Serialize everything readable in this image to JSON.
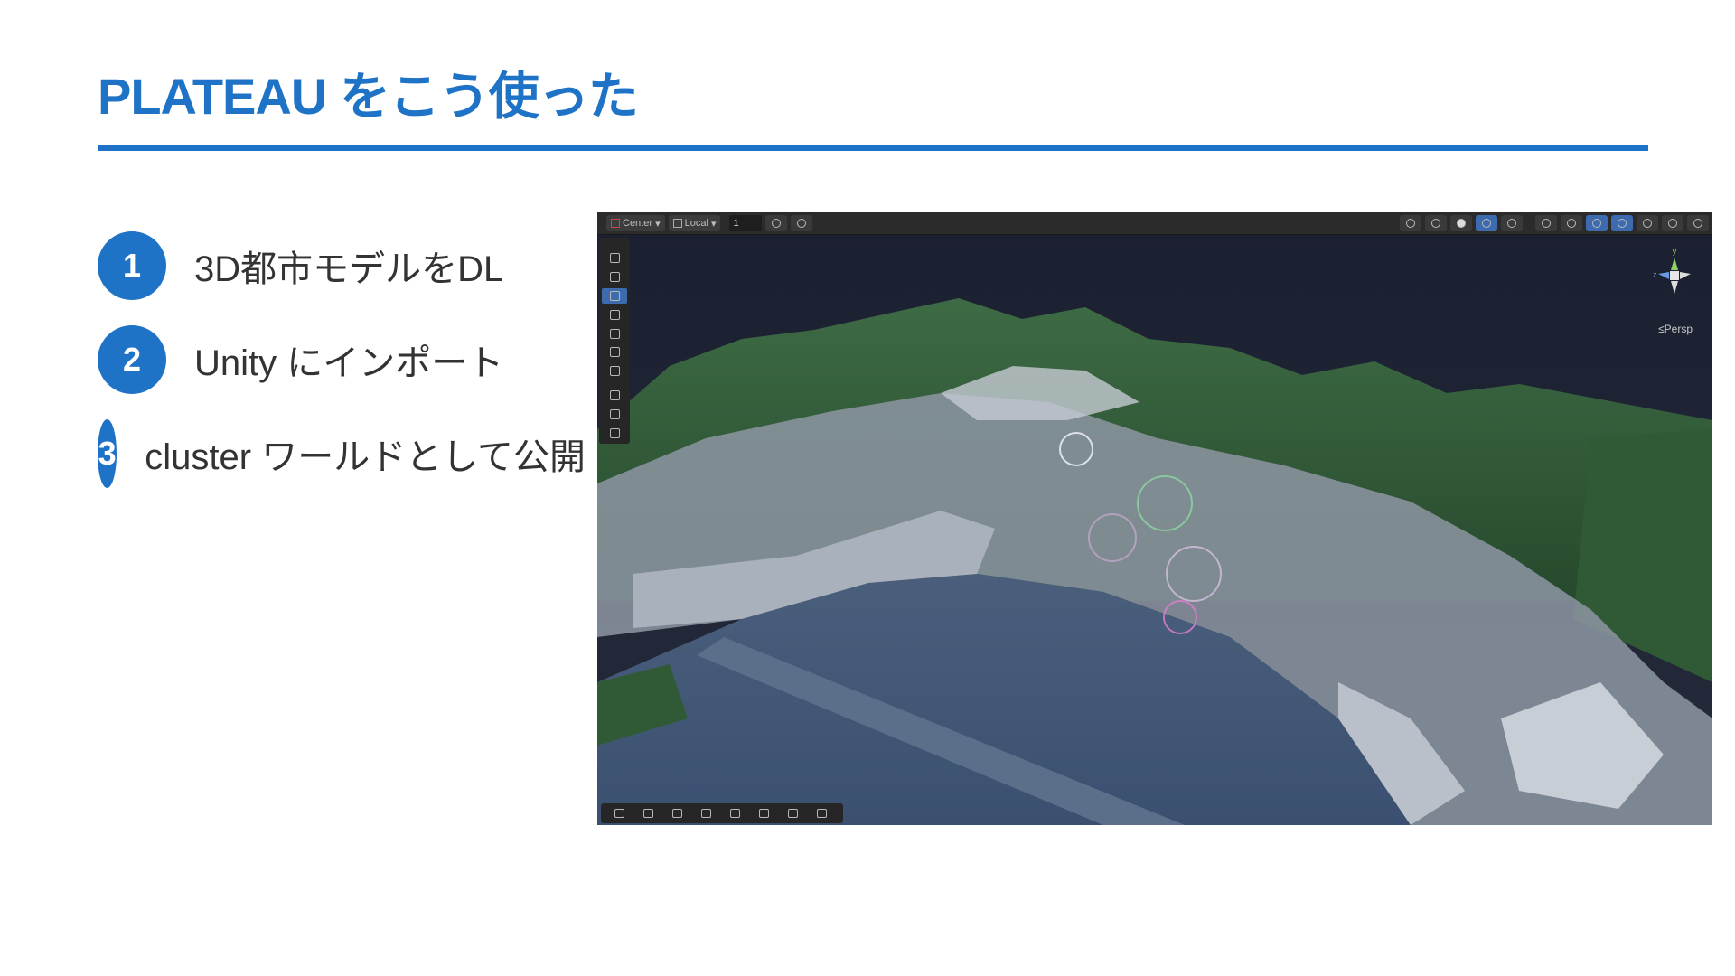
{
  "slide": {
    "title": "PLATEAU をこう使った",
    "steps": [
      {
        "num": "1",
        "label": "3D都市モデルをDL"
      },
      {
        "num": "2",
        "label": "Unity にインポート"
      },
      {
        "num": "3",
        "label": "cluster ワールドとして公開"
      }
    ],
    "accent_color": "#1f73c7"
  },
  "scene_view": {
    "toolbar": {
      "pivot_label": "Center",
      "space_label": "Local",
      "grid_value": "1"
    },
    "gizmo": {
      "axis_y": "y",
      "axis_z": "z",
      "projection_label": "≤Persp"
    },
    "tools": [
      "view-tool",
      "hand-tool",
      "move-tool",
      "rotate-tool",
      "scale-tool",
      "rect-tool",
      "transform-tool",
      "custom-tool-1",
      "custom-tool-2",
      "custom-tool-3"
    ],
    "overlay_buttons": [
      "move-icon",
      "layers-icon",
      "grid-icon",
      "shading-icon",
      "terrain-icon",
      "search-icon",
      "transform-icon",
      "camera-icon"
    ]
  }
}
